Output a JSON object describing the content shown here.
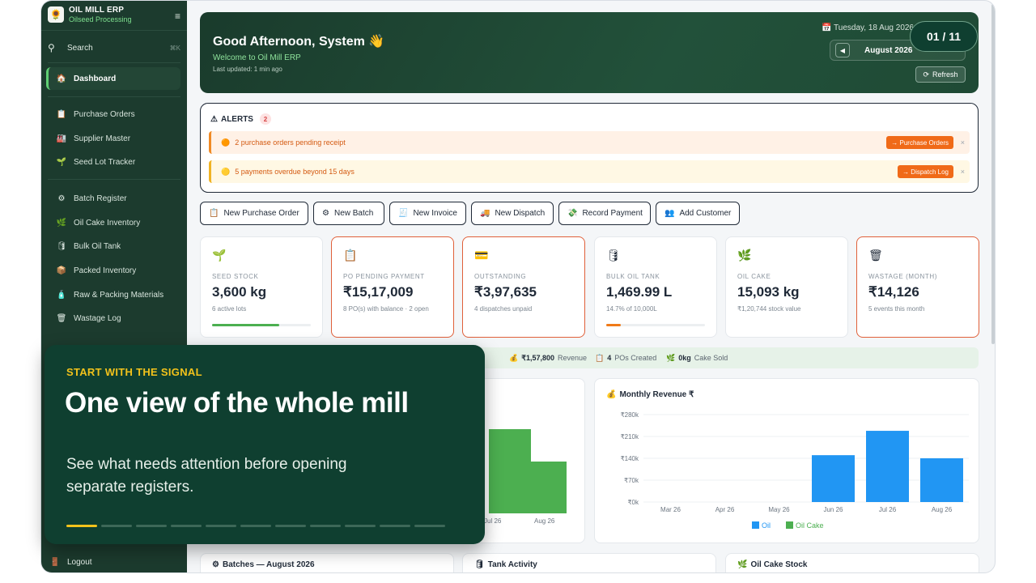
{
  "app": {
    "title": "OIL MILL ERP",
    "subtitle": "Oilseed Processing",
    "logo_icon": "oil-drop"
  },
  "sidebar": {
    "search_label": "Search",
    "search_shortcut": "⌘K",
    "items": [
      {
        "label": "Dashboard",
        "icon": "🏠",
        "active": true
      },
      {
        "label": "Purchase Orders",
        "icon": "📋"
      },
      {
        "label": "Supplier Master",
        "icon": "🏭"
      },
      {
        "label": "Seed Lot Tracker",
        "icon": "🌱"
      },
      {
        "label": "Batch Register",
        "icon": "⚙"
      },
      {
        "label": "Oil Cake Inventory",
        "icon": "🌿"
      },
      {
        "label": "Bulk Oil Tank",
        "icon": "🛢"
      },
      {
        "label": "Packed Inventory",
        "icon": "📦"
      },
      {
        "label": "Raw & Packing Materials",
        "icon": "🧴"
      },
      {
        "label": "Wastage Log",
        "icon": "🗑"
      }
    ],
    "logout_label": "Logout"
  },
  "hero": {
    "greeting": "Good Afternoon, System 👋",
    "welcome": "Welcome to Oil Mill ERP",
    "last_updated": "Last updated: 1 min ago",
    "date": "📅 Tuesday, 18 Aug 2026",
    "month": "August 2026",
    "refresh_label": "Refresh"
  },
  "alerts": {
    "title": "ALERTS",
    "count": "2",
    "items": [
      {
        "text": "2 purchase orders pending receipt",
        "action": "→ Purchase Orders"
      },
      {
        "text": "5 payments overdue beyond 15 days",
        "action": "→ Dispatch Log"
      }
    ]
  },
  "quick_actions": [
    {
      "label": "New Purchase Order",
      "icon": "📋"
    },
    {
      "label": "New Batch",
      "icon": "⚙"
    },
    {
      "label": "New Invoice",
      "icon": "🧾"
    },
    {
      "label": "New Dispatch",
      "icon": "🚚"
    },
    {
      "label": "Record Payment",
      "icon": "💸"
    },
    {
      "label": "Add Customer",
      "icon": "👥"
    }
  ],
  "kpis": [
    {
      "icon": "🌱",
      "label": "SEED STOCK",
      "value": "3,600 kg",
      "sub": "6 active lots",
      "progress": 0.68,
      "bar_color": "#4caf50"
    },
    {
      "icon": "📋",
      "label": "PO PENDING PAYMENT",
      "value": "₹15,17,009",
      "sub": "8 PO(s) with balance · 2 open",
      "alert": true
    },
    {
      "icon": "💳",
      "label": "OUTSTANDING",
      "value": "₹3,97,635",
      "sub": "4 dispatches unpaid",
      "alert": true
    },
    {
      "icon": "🛢",
      "label": "BULK OIL TANK",
      "value": "1,469.99 L",
      "sub": "14.7% of 10,000L",
      "progress": 0.147,
      "bar_color": "#f07a18"
    },
    {
      "icon": "🌿",
      "label": "OIL CAKE",
      "value": "15,093 kg",
      "sub": "₹1,20,744 stock value"
    },
    {
      "icon": "🗑",
      "label": "WASTAGE (MONTH)",
      "value": "₹14,126",
      "sub": "5 events this month",
      "alert": true
    }
  ],
  "strip": {
    "revenue_value": "₹1,57,800",
    "revenue_label": "Revenue",
    "pos_value": "4",
    "pos_label": "POs Created",
    "cake_value": "0kg",
    "cake_label": "Cake Sold"
  },
  "production_chart": {
    "x_labels": [
      "Jul 26",
      "Aug 26"
    ]
  },
  "chart_data": {
    "type": "bar",
    "title": "Monthly Revenue ₹",
    "categories": [
      "Mar 26",
      "Apr 26",
      "May 26",
      "Jun 26",
      "Jul 26",
      "Aug 26"
    ],
    "series": [
      {
        "name": "Oil",
        "values": [
          0,
          0,
          0,
          150000,
          228000,
          140000
        ],
        "color": "#2196f3"
      },
      {
        "name": "Oil Cake",
        "values": [
          0,
          0,
          0,
          0,
          0,
          0
        ],
        "color": "#4caf50"
      }
    ],
    "y_ticks": [
      "₹0k",
      "₹70k",
      "₹140k",
      "₹210k",
      "₹280k"
    ],
    "ylim": [
      0,
      280000
    ],
    "legend": "bottom"
  },
  "bottom_cards": [
    {
      "title": "Batches — August 2026",
      "icon": "⚙"
    },
    {
      "title": "Tank Activity",
      "icon": "🛢"
    },
    {
      "title": "Oil Cake Stock",
      "icon": "🌿"
    }
  ],
  "overlay": {
    "kicker": "START WITH THE SIGNAL",
    "title": "One view of the whole mill",
    "body": "See what needs attention before opening separate registers.",
    "step": 1,
    "total": 11
  },
  "pager": "01 / 11"
}
